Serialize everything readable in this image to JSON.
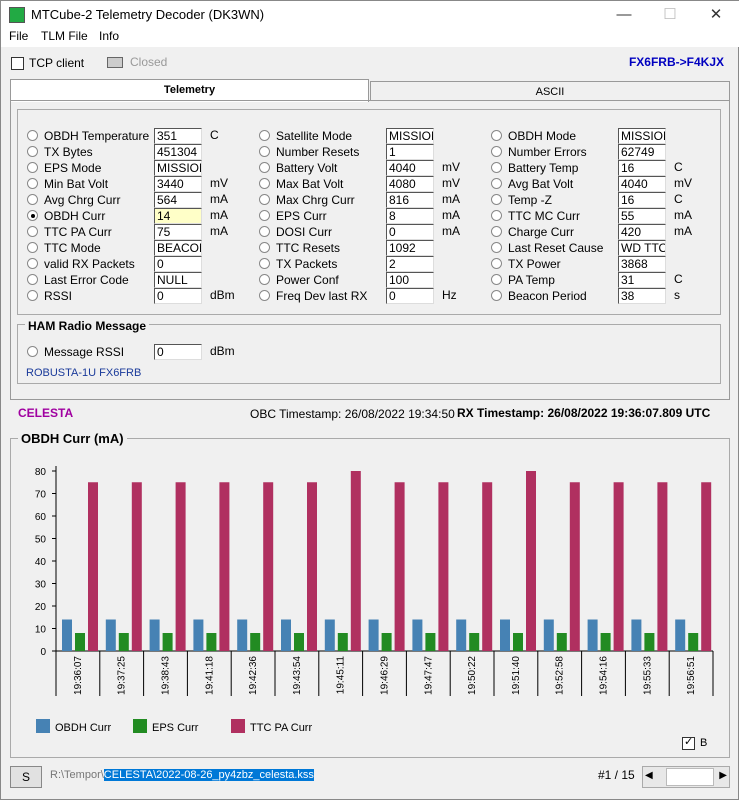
{
  "window": {
    "title": "MTCube-2 Telemetry Decoder (DK3WN)",
    "min": "—",
    "max": "☐",
    "close": "✕"
  },
  "menu": [
    "File",
    "TLM File",
    "Info"
  ],
  "toolbar": {
    "tcp_client": "TCP client",
    "status": "Closed",
    "callsign": "FX6FRB->F4KJX"
  },
  "tabs": [
    "Telemetry",
    "ASCII"
  ],
  "columns": [
    [
      {
        "label": "OBDH Temperature",
        "value": "351",
        "unit": "C"
      },
      {
        "label": "TX Bytes",
        "value": "451304",
        "unit": ""
      },
      {
        "label": "EPS Mode",
        "value": "MISSION",
        "unit": ""
      },
      {
        "label": "Min Bat Volt",
        "value": "3440",
        "unit": "mV"
      },
      {
        "label": "Avg Chrg Curr",
        "value": "564",
        "unit": "mA"
      },
      {
        "label": "OBDH Curr",
        "value": "14",
        "unit": "mA",
        "selected": true
      },
      {
        "label": "TTC PA Curr",
        "value": "75",
        "unit": "mA"
      },
      {
        "label": "TTC Mode",
        "value": "BEACON",
        "unit": ""
      },
      {
        "label": "valid RX Packets",
        "value": "0",
        "unit": ""
      },
      {
        "label": "Last Error Code",
        "value": "NULL",
        "unit": ""
      },
      {
        "label": "RSSI",
        "value": "0",
        "unit": "dBm"
      }
    ],
    [
      {
        "label": "Satellite Mode",
        "value": "MISSION",
        "unit": ""
      },
      {
        "label": "Number Resets",
        "value": "1",
        "unit": ""
      },
      {
        "label": "Battery Volt",
        "value": "4040",
        "unit": "mV"
      },
      {
        "label": "Max Bat Volt",
        "value": "4080",
        "unit": "mV"
      },
      {
        "label": "Max Chrg Curr",
        "value": "816",
        "unit": "mA"
      },
      {
        "label": "EPS Curr",
        "value": "8",
        "unit": "mA"
      },
      {
        "label": "DOSI Curr",
        "value": "0",
        "unit": "mA"
      },
      {
        "label": "TTC Resets",
        "value": "1092",
        "unit": ""
      },
      {
        "label": "TX Packets",
        "value": "2",
        "unit": ""
      },
      {
        "label": "Power Conf",
        "value": "100",
        "unit": ""
      },
      {
        "label": "Freq Dev last RX",
        "value": "0",
        "unit": "Hz"
      }
    ],
    [
      {
        "label": "OBDH Mode",
        "value": "MISSION",
        "unit": ""
      },
      {
        "label": "Number Errors",
        "value": "62749",
        "unit": ""
      },
      {
        "label": "Battery Temp",
        "value": "16",
        "unit": "C"
      },
      {
        "label": "Avg Bat Volt",
        "value": "4040",
        "unit": "mV"
      },
      {
        "label": "Temp -Z",
        "value": "16",
        "unit": "C"
      },
      {
        "label": "TTC MC Curr",
        "value": "55",
        "unit": "mA"
      },
      {
        "label": "Charge Curr",
        "value": "420",
        "unit": "mA"
      },
      {
        "label": "Last Reset Cause",
        "value": "WD TTO",
        "unit": ""
      },
      {
        "label": "TX Power",
        "value": "3868",
        "unit": ""
      },
      {
        "label": "PA Temp",
        "value": "31",
        "unit": "C"
      },
      {
        "label": "Beacon Period",
        "value": "38",
        "unit": "s"
      }
    ]
  ],
  "ham": {
    "title": "HAM Radio Message",
    "label": "Message RSSI",
    "value": "0",
    "unit": "dBm",
    "message": "ROBUSTA-1U FX6FRB"
  },
  "info": {
    "satellite": "CELESTA",
    "obc": "OBC Timestamp: 26/08/2022 19:34:50",
    "rx": "RX Timestamp: 26/08/2022 19:36:07.809 UTC"
  },
  "chart_data": {
    "type": "bar",
    "title": "OBDH Curr (mA)",
    "ylim": [
      0,
      80
    ],
    "yticks": [
      0,
      10,
      20,
      30,
      40,
      50,
      60,
      70,
      80
    ],
    "categories": [
      "19:36:07",
      "19:37:25",
      "19:38:43",
      "19:41:18",
      "19:42:36",
      "19:43:54",
      "19:45:11",
      "19:46:29",
      "19:47:47",
      "19:50:22",
      "19:51:40",
      "19:52:58",
      "19:54:16",
      "19:55:33",
      "19:56:51"
    ],
    "series": [
      {
        "name": "OBDH Curr",
        "color": "#4682b4",
        "values": [
          14,
          14,
          14,
          14,
          14,
          14,
          14,
          14,
          14,
          14,
          14,
          14,
          14,
          14,
          14
        ]
      },
      {
        "name": "EPS Curr",
        "color": "#228b22",
        "values": [
          8,
          8,
          8,
          8,
          8,
          8,
          8,
          8,
          8,
          8,
          8,
          8,
          8,
          8,
          8
        ]
      },
      {
        "name": "TTC PA Curr",
        "color": "#b03060",
        "values": [
          75,
          75,
          75,
          75,
          75,
          75,
          80,
          75,
          75,
          75,
          80,
          75,
          75,
          75,
          75
        ]
      }
    ],
    "legend": "bottom-left"
  },
  "chart_opts": {
    "b_label": "B"
  },
  "status": {
    "s_button": "S",
    "path_prefix": "R:\\Tempor\\",
    "path_selected": "CELESTA\\2022-08-26_py4zbz_celesta.kss",
    "record": "#1 / 15"
  }
}
